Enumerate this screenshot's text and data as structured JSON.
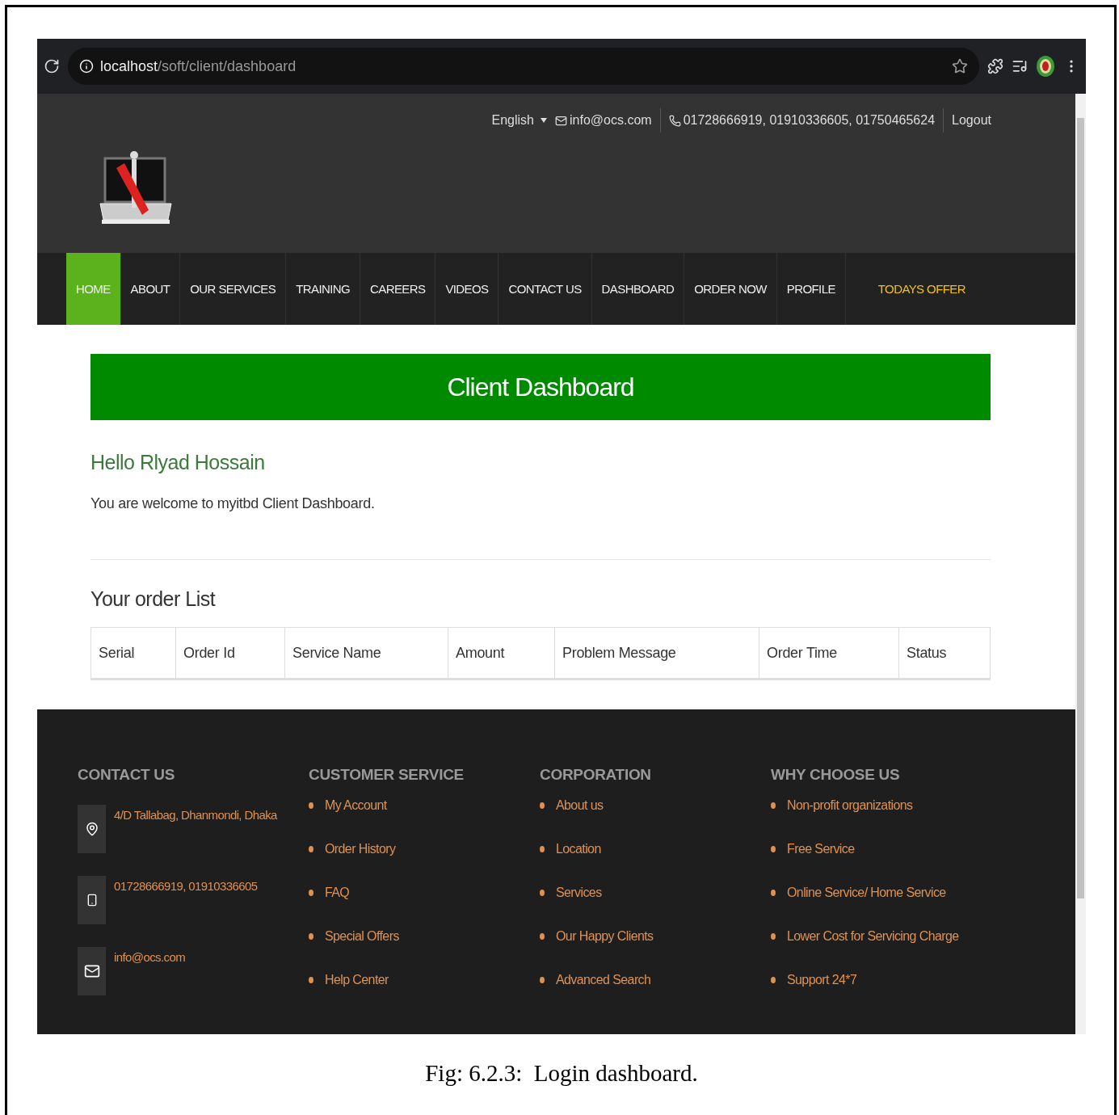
{
  "browser": {
    "url_host": "localhost",
    "url_path": "/soft/client/dashboard"
  },
  "topbar": {
    "language": "English",
    "email": "info@ocs.com",
    "phones": "01728666919, 01910336605, 01750465624",
    "logout": "Logout"
  },
  "nav": [
    {
      "label": "HOME",
      "kind": "link",
      "selected": true
    },
    {
      "label": "ABOUT",
      "kind": "link",
      "selected": false
    },
    {
      "label": "OUR SERVICES",
      "kind": "link",
      "selected": false
    },
    {
      "label": "TRAINING",
      "kind": "link",
      "selected": false
    },
    {
      "label": "CAREERS",
      "kind": "link",
      "selected": false
    },
    {
      "label": "VIDEOS",
      "kind": "link",
      "selected": false
    },
    {
      "label": "CONTACT US",
      "kind": "link",
      "selected": false
    },
    {
      "label": "DASHBOARD",
      "kind": "link",
      "selected": false
    },
    {
      "label": "ORDER NOW",
      "kind": "link",
      "selected": false
    },
    {
      "label": "PROFILE",
      "kind": "link",
      "selected": false
    },
    {
      "label": "TODAYS OFFER",
      "kind": "offer",
      "selected": false
    }
  ],
  "banner": {
    "title": "Client Dashboard"
  },
  "greeting": "Hello Rlyad Hossain",
  "welcome": "You are welcome to myitbd Client Dashboard.",
  "order_list": {
    "title": "Your order List",
    "columns": [
      "Serial",
      "Order Id",
      "Service Name",
      "Amount",
      "Problem Message",
      "Order Time",
      "Status"
    ]
  },
  "footer": {
    "contact": {
      "heading": "CONTACT US",
      "items": [
        {
          "kind": "location",
          "text": "4/D Tallabag, Dhanmondi, Dhaka"
        },
        {
          "kind": "phone",
          "text": "01728666919, 01910336605"
        },
        {
          "kind": "email",
          "text": "info@ocs.com"
        }
      ]
    },
    "lists": [
      {
        "heading": "CUSTOMER SERVICE",
        "items": [
          "My Account",
          "Order History",
          "FAQ",
          "Special Offers",
          "Help Center"
        ]
      },
      {
        "heading": "CORPORATION",
        "items": [
          "About us",
          "Location",
          "Services",
          "Our Happy Clients",
          "Advanced Search"
        ]
      },
      {
        "heading": "WHY CHOOSE US",
        "items": [
          "Non-profit organizations",
          "Free Service",
          "Online Service/ Home Service",
          "Lower Cost for Servicing Charge",
          "Support 24*7"
        ]
      }
    ]
  },
  "caption": "Fig: 6.2.3:  Login dashboard."
}
